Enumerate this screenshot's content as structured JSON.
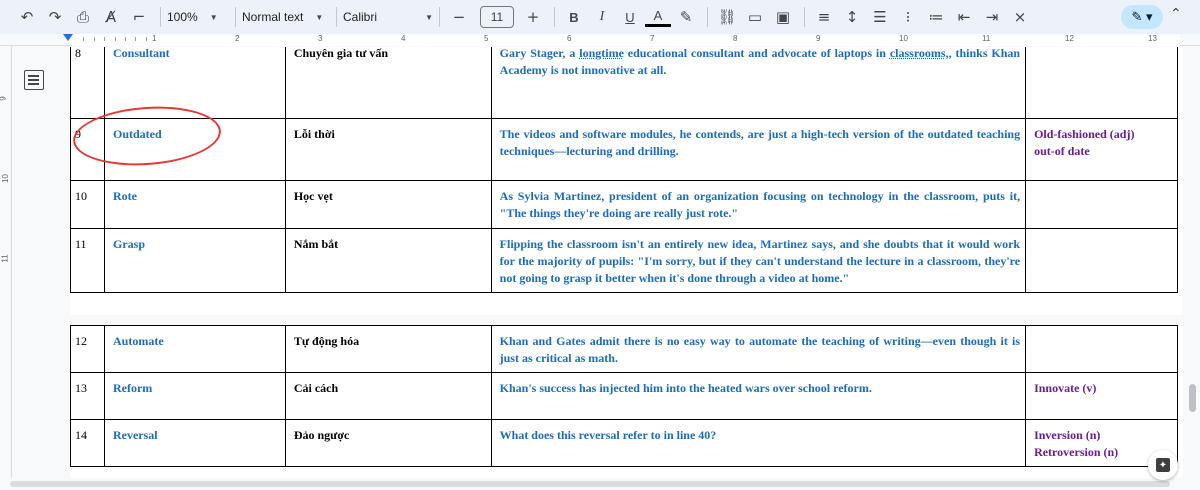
{
  "toolbar": {
    "zoom": "100%",
    "style": "Normal text",
    "font": "Calibri",
    "font_size": "11",
    "minus": "−",
    "plus": "+",
    "bold": "B",
    "italic": "I",
    "underline": "U",
    "text_color": "A",
    "icons": [
      "undo-icon",
      "redo-icon",
      "print-icon",
      "spellcheck-icon",
      "paint-format-icon",
      "bold-icon",
      "italic-icon",
      "underline-icon",
      "text-color-icon",
      "highlight-icon",
      "link-icon",
      "comment-icon",
      "image-icon",
      "align-icon",
      "line-spacing-icon",
      "checklist-icon",
      "bulleted-list-icon",
      "numbered-list-icon",
      "decrease-indent-icon",
      "increase-indent-icon",
      "clear-formatting-icon",
      "editing-mode-icon",
      "collapse-icon"
    ]
  },
  "ruler": {
    "numbers": [
      "1",
      "2",
      "3",
      "4",
      "5",
      "6",
      "7",
      "8",
      "9",
      "10",
      "11",
      "12",
      "13"
    ]
  },
  "vruler": {
    "numbers": [
      "9",
      "10",
      "11"
    ]
  },
  "colors": {
    "word_blue": "#1c6bbf",
    "synonym_purple": "#6a1b9a",
    "annotation_red": "#e53935",
    "accent": "#c2e7ff"
  },
  "rows_page1": [
    {
      "num": "8",
      "word": "Consultant",
      "meaning": "Chuyên gia tư vấn",
      "example_parts": [
        "Gary Stager, a ",
        "longtime",
        " educational consultant and advocate of laptops in ",
        "classrooms,",
        ", thinks Khan Academy is not innovative at all."
      ],
      "synonym": []
    },
    {
      "num": "9",
      "word": "Outdated",
      "meaning": "Lỗi thời",
      "example": "The videos and software modules, he contends, are just a high-tech version of the outdated teaching techniques—lecturing and drilling.",
      "synonym": [
        "Old-fashioned (adj)",
        "out-of date"
      ]
    },
    {
      "num": "10",
      "word": "Rote",
      "meaning": "Học vẹt",
      "example": "As Sylvia Martinez, president of an organization focusing on technology in the classroom, puts it, \"The things they're doing are really just rote.\"",
      "synonym": []
    },
    {
      "num": "11",
      "word": "Grasp",
      "meaning": "Nắm bắt",
      "example": "Flipping the classroom isn't an entirely new idea, Martinez says, and she doubts that it would work for the majority of pupils: \"I'm sorry, but if they can't understand the lecture in a classroom, they're not going to grasp it better when it's done through a video at home.\"",
      "synonym": []
    }
  ],
  "rows_page2": [
    {
      "num": "12",
      "word": "Automate",
      "meaning": "Tự động hóa",
      "example": "Khan and Gates admit there is no easy way to automate the teaching of writing—even though it is just as critical as math.",
      "synonym": []
    },
    {
      "num": "13",
      "word": "Reform",
      "meaning": "Cải cách",
      "example": "Khan's success has injected him into the heated wars over school reform.",
      "synonym": [
        "Innovate (v)"
      ]
    },
    {
      "num": "14",
      "word": "Reversal",
      "meaning": "Đảo ngược",
      "example": "What does this reversal refer to in line 40?",
      "synonym": [
        "Inversion (n)",
        "Retroversion (n)"
      ]
    }
  ]
}
